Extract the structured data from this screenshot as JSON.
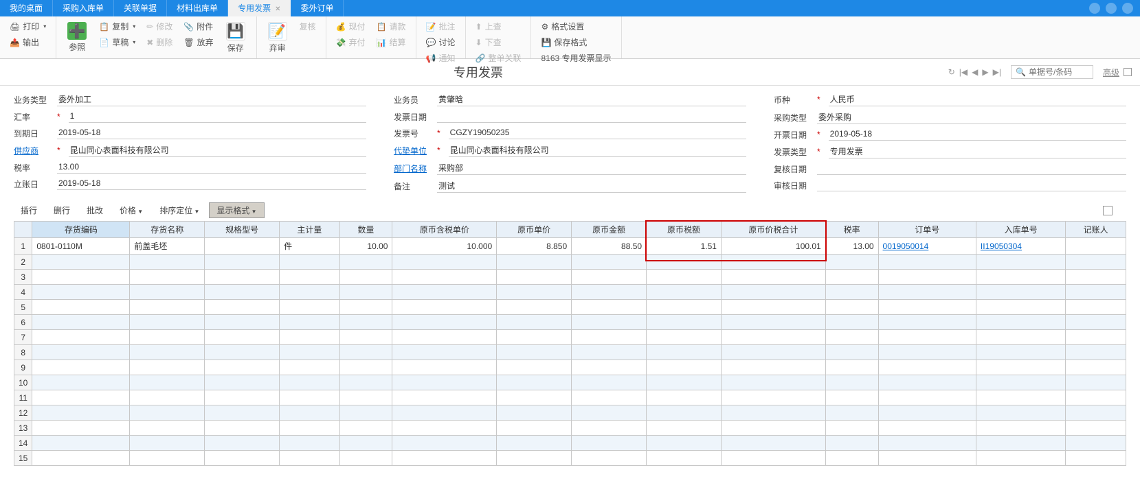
{
  "tabs": {
    "t0": "我的桌面",
    "t1": "采购入库单",
    "t2": "关联单据",
    "t3": "材料出库单",
    "t4": "专用发票",
    "t5": "委外订单"
  },
  "ribbon": {
    "print": "打印",
    "output": "输出",
    "reference": "参照",
    "copy": "复制",
    "draft": "草稿",
    "modify": "修改",
    "delete": "删除",
    "attach": "附件",
    "discard": "放弃",
    "save": "保存",
    "abandon": "弃审",
    "recheck": "复核",
    "cash": "现付",
    "abandon2": "弃付",
    "request": "请款",
    "settle": "结算",
    "approve": "批注",
    "discuss": "讨论",
    "notify": "通知",
    "up": "上查",
    "down": "下查",
    "whole": "整单关联",
    "format": "格式设置",
    "saveformat": "保存格式",
    "code": "8163 专用发票显示"
  },
  "title": "专用发票",
  "search_placeholder": "单据号/条码",
  "advanced": "高级",
  "form": {
    "biz_type_label": "业务类型",
    "biz_type": "委外加工",
    "rate_label": "汇率",
    "rate": "1",
    "due_label": "到期日",
    "due": "2019-05-18",
    "supplier_label": "供应商",
    "supplier": "昆山同心表面科技有限公司",
    "tax_label": "税率",
    "tax": "13.00",
    "acc_label": "立账日",
    "acc": "2019-05-18",
    "sales_label": "业务员",
    "sales": "黄肇晗",
    "inv_date_label": "发票日期",
    "inv_date": "",
    "inv_no_label": "发票号",
    "inv_no": "CGZY19050235",
    "agent_label": "代垫单位",
    "agent": "昆山同心表面科技有限公司",
    "dept_label": "部门名称",
    "dept": "采购部",
    "remark_label": "备注",
    "remark": "测试",
    "currency_label": "币种",
    "currency": "人民币",
    "pur_type_label": "采购类型",
    "pur_type": "委外采购",
    "issue_label": "开票日期",
    "issue": "2019-05-18",
    "inv_type_label": "发票类型",
    "inv_type": "专用发票",
    "check_label": "复核日期",
    "check": "",
    "audit_label": "审核日期",
    "audit": ""
  },
  "toolbar": {
    "insert": "插行",
    "delrow": "删行",
    "batch": "批改",
    "price": "价格",
    "sort": "排序定位",
    "display": "显示格式"
  },
  "columns": {
    "c1": "存货编码",
    "c2": "存货名称",
    "c3": "规格型号",
    "c4": "主计量",
    "c5": "数量",
    "c6": "原币含税单价",
    "c7": "原币单价",
    "c8": "原币金额",
    "c9": "原币税额",
    "c10": "原币价税合计",
    "c11": "税率",
    "c12": "订单号",
    "c13": "入库单号",
    "c14": "记账人"
  },
  "row1": {
    "code": "0801-0110M",
    "name": "前盖毛坯",
    "spec": "",
    "uom": "件",
    "qty": "10.00",
    "taxprice": "10.000",
    "price": "8.850",
    "amount": "88.50",
    "taxamt": "1.51",
    "total": "100.01",
    "taxrate": "13.00",
    "order": "0019050014",
    "stockin": "II19050304",
    "acct": ""
  }
}
